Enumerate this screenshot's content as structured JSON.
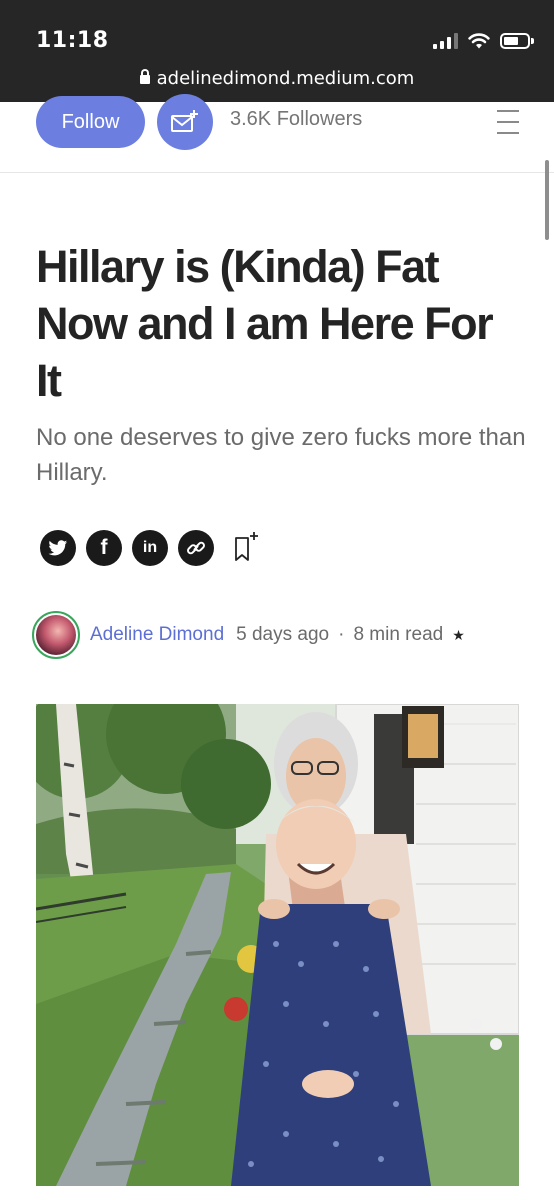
{
  "status_bar": {
    "time": "11:18",
    "url": "adelinedimond.medium.com"
  },
  "profile_header": {
    "follow_label": "Follow",
    "followers": "3.6K Followers",
    "accent_color": "#6c7fe0"
  },
  "article": {
    "title": "Hillary is (Kinda) Fat Now and I am Here For It",
    "subtitle": "No one deserves to give zero fucks more than Hillary.",
    "share_icons": [
      "twitter-icon",
      "facebook-icon",
      "linkedin-icon",
      "link-icon"
    ],
    "share_labels": {
      "facebook": "f",
      "linkedin": "in"
    },
    "author": {
      "name": "Adeline Dimond",
      "date": "5 days ago",
      "separator": "·",
      "read_time": "8 min read",
      "member_star": "★"
    }
  }
}
